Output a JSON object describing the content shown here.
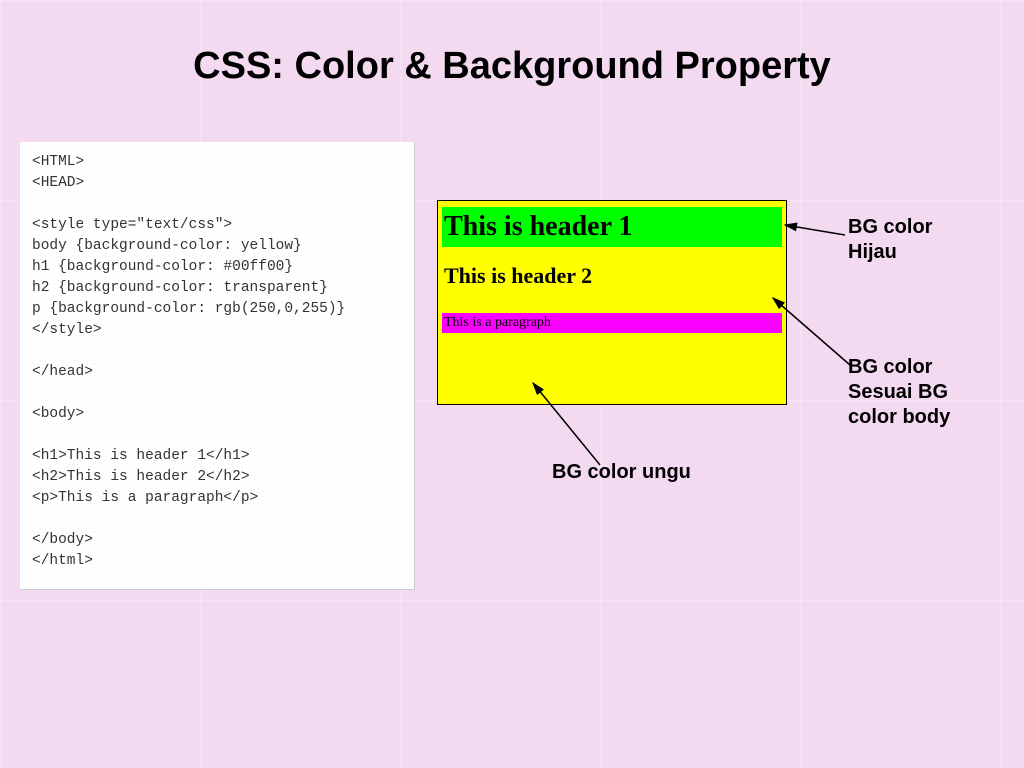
{
  "title": "CSS: Color & Background Property",
  "code": "<HTML>\n<HEAD>\n\n<style type=\"text/css\">\nbody {background-color: yellow}\nh1 {background-color: #00ff00}\nh2 {background-color: transparent}\np {background-color: rgb(250,0,255)}\n</style>\n\n</head>\n\n<body>\n\n<h1>This is header 1</h1>\n<h2>This is header 2</h2>\n<p>This is a paragraph</p>\n\n</body>\n</html>",
  "preview": {
    "h1": "This is header 1",
    "h2": "This is header 2",
    "p": "This is a paragraph"
  },
  "annotations": {
    "hijau": "BG color\nHijau",
    "sesuai": "BG color\nSesuai BG\ncolor body",
    "ungu": "BG color ungu"
  }
}
